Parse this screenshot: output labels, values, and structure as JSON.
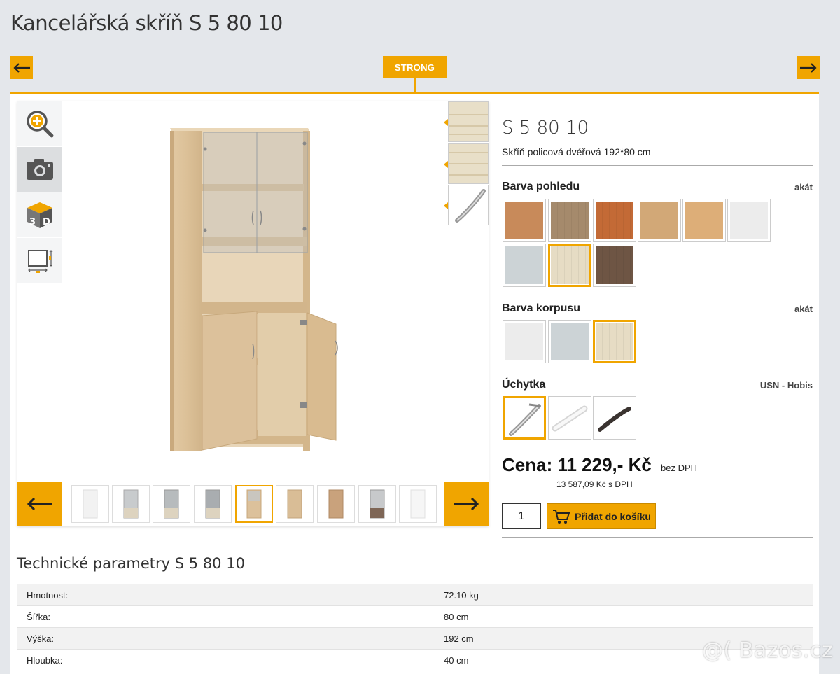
{
  "page": {
    "title": "Kancelářská skříň S 5 80 10"
  },
  "nav": {
    "brand": "STRONG"
  },
  "viewer": {
    "tools": [
      "zoom-icon",
      "camera-icon",
      "3d-icon",
      "dimensions-icon"
    ],
    "active_tool": 1
  },
  "product": {
    "code": "S 5 80 10",
    "description": "Skříň policová dvéřová 192*80 cm"
  },
  "options": {
    "view_color": {
      "label": "Barva pohledu",
      "value": "akát",
      "swatches": [
        "#c88a5a",
        "#a58a6c",
        "#c36a36",
        "#d2a877",
        "#ddae78",
        "#ececec",
        "#ccd3d6",
        "#e6dcc4",
        "#6e5544"
      ],
      "selected": 7
    },
    "body_color": {
      "label": "Barva korpusu",
      "value": "akát",
      "swatches": [
        "#ececec",
        "#ccd3d6",
        "#e6dcc4"
      ],
      "selected": 2
    },
    "handle": {
      "label": "Úchytka",
      "value": "USN - Hobis",
      "items": [
        "curved-chrome-handle-icon",
        "white-bar-handle-icon",
        "dark-curved-handle-icon"
      ],
      "selected": 0
    }
  },
  "price": {
    "main": "Cena: 11 229,- Kč",
    "vat_note": "bez DPH",
    "gross": "13 587,09 Kč s DPH"
  },
  "cart": {
    "quantity": "1",
    "add_label": "Přidat do košíku"
  },
  "tech": {
    "title": "Technické parametry S 5 80 10",
    "rows": [
      {
        "k": "Hmotnost:",
        "v": "72.10 kg"
      },
      {
        "k": "Šířka:",
        "v": "80 cm"
      },
      {
        "k": "Výška:",
        "v": "192 cm"
      },
      {
        "k": "Hloubka:",
        "v": "40 cm"
      }
    ]
  },
  "watermark": "@( Bazos.cz"
}
